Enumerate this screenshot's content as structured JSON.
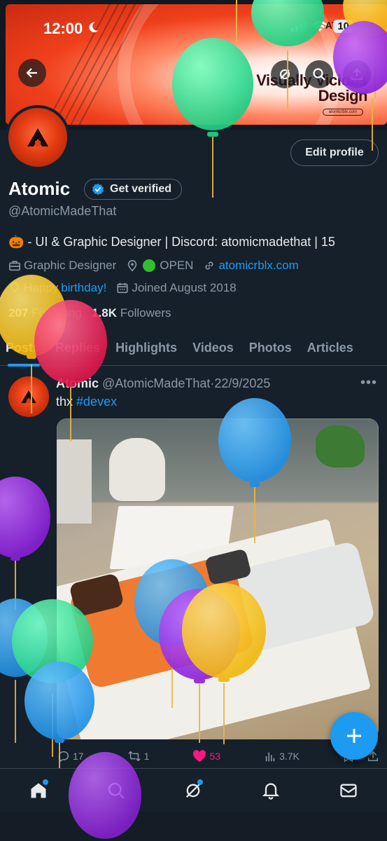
{
  "status": {
    "time": "12:00",
    "battery": "10"
  },
  "banner": {
    "title_line1": "Visually Vicious",
    "title_line2": "Design",
    "logo_text": "ATO",
    "url": "atomicrblx.com"
  },
  "profile": {
    "name": "Atomic",
    "verify_label": "Get verified",
    "handle": "@AtomicMadeThat",
    "edit_label": "Edit profile",
    "bio": "🎃 - UI & Graphic Designer | Discord: atomicmadethat | 15",
    "category": "Graphic Designer",
    "location": "OPEN",
    "website": "atomicrblx.com",
    "birthday_prefix": "Happy",
    "birthday_link": "birthday!",
    "joined": "Joined August 2018",
    "following_count": "207",
    "following_label": "Following",
    "followers_count": "1.8K",
    "followers_label": "Followers"
  },
  "tabs": [
    "Posts",
    "Replies",
    "Highlights",
    "Videos",
    "Photos",
    "Articles"
  ],
  "post": {
    "author": "Atomic",
    "handle": "@AtomicMadeThat",
    "date": "22/9/2025",
    "text_prefix": "thx",
    "hashtag": "#devex",
    "replies": "17",
    "reposts": "1",
    "likes": "53",
    "views": "3.7K"
  },
  "colors": {
    "accent": "#1d9bf0",
    "like": "#f91880",
    "background": "#15202b"
  },
  "nav": [
    "home-icon",
    "search-icon",
    "grok-icon",
    "notifications-icon",
    "messages-icon"
  ]
}
